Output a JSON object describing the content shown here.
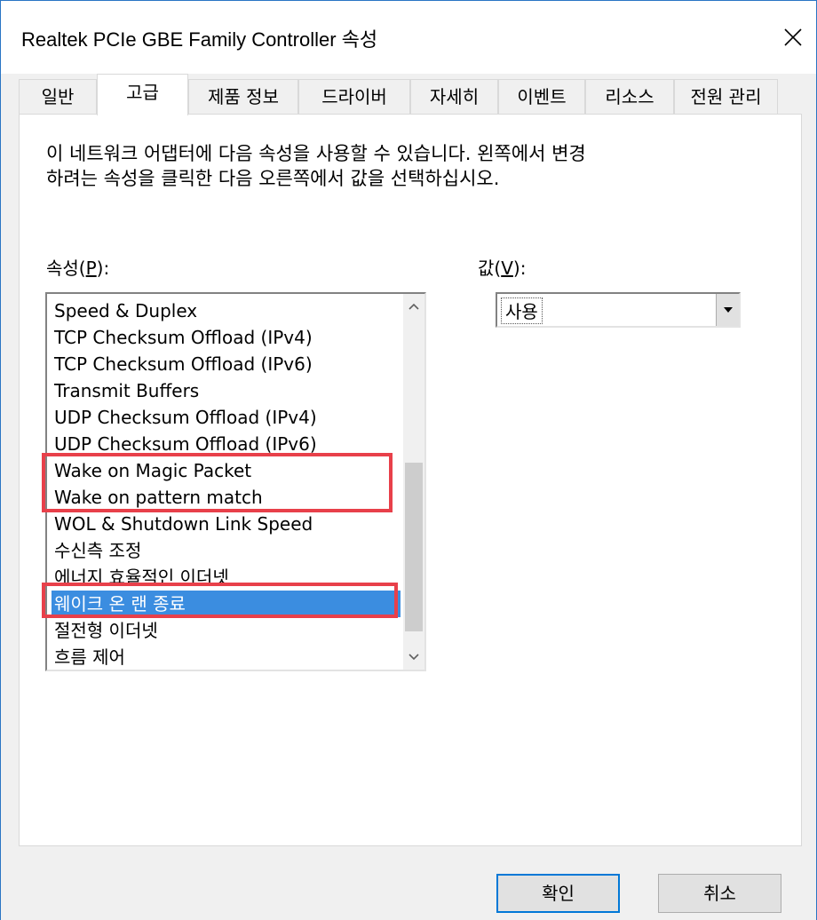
{
  "window": {
    "title": "Realtek PCIe GBE Family Controller 속성",
    "close_glyph": "close-icon"
  },
  "tabs": [
    {
      "label": "일반"
    },
    {
      "label": "고급",
      "active": true
    },
    {
      "label": "제품 정보"
    },
    {
      "label": "드라이버"
    },
    {
      "label": "자세히"
    },
    {
      "label": "이벤트"
    },
    {
      "label": "리소스"
    },
    {
      "label": "전원 관리"
    }
  ],
  "description": {
    "line1": "이 네트워크 어댑터에 다음 속성을 사용할 수 있습니다. 왼쪽에서 변경",
    "line2": "하려는 속성을 클릭한 다음 오른쪽에서 값을 선택하십시오."
  },
  "property": {
    "label_prefix": "속성(",
    "label_mnemonic": "P",
    "label_suffix": "):",
    "items": [
      "Speed & Duplex",
      "TCP Checksum Offload (IPv4)",
      "TCP Checksum Offload (IPv6)",
      "Transmit Buffers",
      "UDP Checksum Offload (IPv4)",
      "UDP Checksum Offload (IPv6)",
      "Wake on Magic Packet",
      "Wake on pattern match",
      "WOL & Shutdown Link Speed",
      "수신측 조정",
      "에너지 효율적인 이더넷",
      "웨이크 온 랜 종료",
      "절전형 이더넷",
      "흐름 제어"
    ],
    "selected": "웨이크 온 랜 종료"
  },
  "value": {
    "label_prefix": "값(",
    "label_mnemonic": "V",
    "label_suffix": "):",
    "selected": "사용"
  },
  "buttons": {
    "ok": "확인",
    "cancel": "취소"
  },
  "colors": {
    "selection": "#3b8de0",
    "highlight_box": "#e8404a",
    "window_border": "#2a75c4"
  }
}
